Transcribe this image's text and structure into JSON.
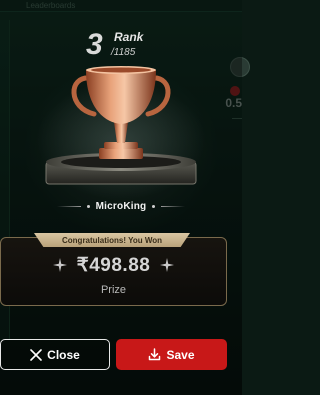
{
  "background": {
    "top_text": "Leaderboards",
    "right_value": "0.5"
  },
  "rank": {
    "position": "3",
    "label": "Rank",
    "total": "/1185"
  },
  "player": {
    "name": "MicroKing"
  },
  "prize": {
    "banner": "Congratulations! You Won",
    "amount": "₹498.88",
    "label": "Prize"
  },
  "actions": {
    "close_label": "Close",
    "save_label": "Save"
  },
  "icons": {
    "trophy": "trophy-icon",
    "close": "close-icon",
    "save": "download-icon",
    "sparkle": "sparkle-icon"
  },
  "colors": {
    "save_button": "#c81818",
    "trophy": "#c9744a",
    "card_border": "#7a6a4c"
  }
}
